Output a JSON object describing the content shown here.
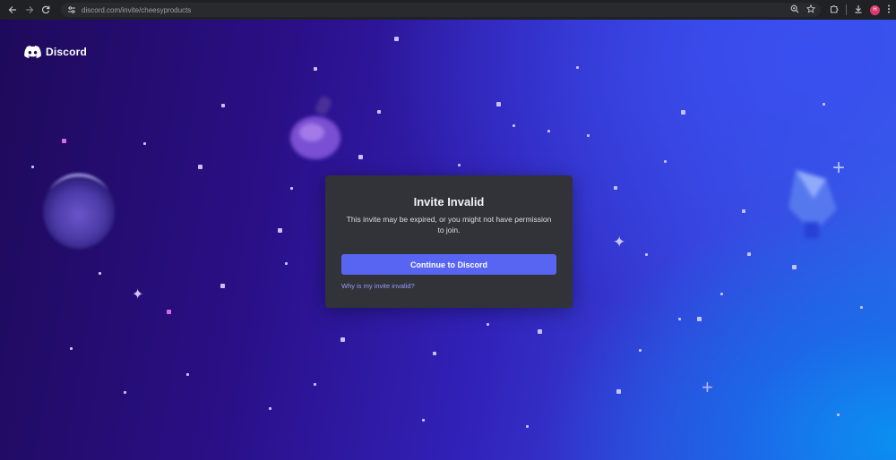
{
  "browser": {
    "url": "discord.com/invite/cheesyproducts",
    "profile_initial": "H"
  },
  "brand": {
    "name": "Discord",
    "accent": "#5865f2",
    "link_color": "#949cf7"
  },
  "modal": {
    "title": "Invite Invalid",
    "description": "This invite may be expired, or you might not have permission to join.",
    "primary_button": "Continue to Discord",
    "help_link": "Why is my invite invalid?"
  },
  "icons": {
    "back": "arrow-left-icon",
    "forward": "arrow-right-icon",
    "reload": "reload-icon",
    "site_settings": "tune-icon",
    "zoom": "zoom-icon",
    "bookmark": "star-icon",
    "extensions": "puzzle-icon",
    "downloads": "download-icon",
    "menu": "kebab-menu-icon",
    "logo": "discord-logo-icon"
  }
}
